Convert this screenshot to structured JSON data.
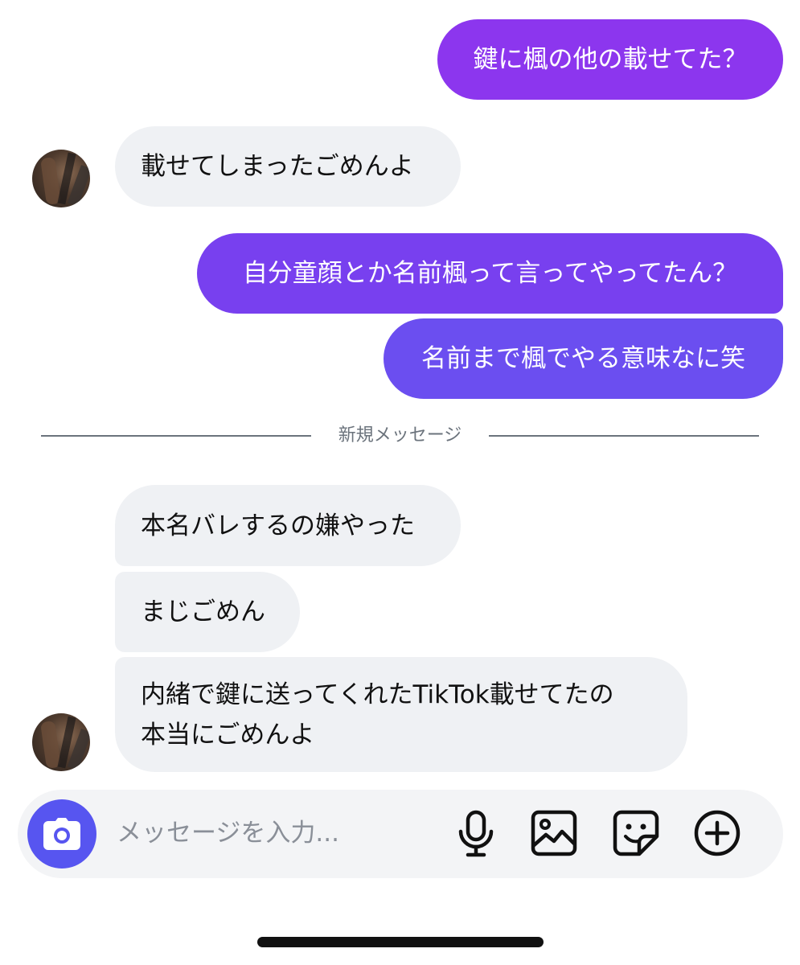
{
  "conversation": {
    "messages": [
      {
        "from": "me",
        "text": "鍵に楓の他の載せてた？"
      },
      {
        "from": "them",
        "text": "載せてしまったごめんよ"
      },
      {
        "from": "me",
        "text": "自分童顔とか名前楓って言ってやってたん？"
      },
      {
        "from": "me",
        "text": "名前まで楓でやる意味なに笑"
      },
      {
        "from": "them",
        "text": "本名バレするの嫌やった"
      },
      {
        "from": "them",
        "text": "まじごめん"
      },
      {
        "from": "them",
        "text": "内緒で鍵に送ってくれたTikTok載せてたの 本当にごめんよ",
        "lines": [
          "内緒で鍵に送ってくれたTikTok載せてたの",
          "本当にごめんよ"
        ]
      }
    ],
    "divider_label": "新規メッセージ"
  },
  "composer": {
    "placeholder": "メッセージを入力...",
    "buttons": [
      "camera-icon",
      "microphone-icon",
      "image-icon",
      "sticker-icon",
      "plus-circle-icon"
    ]
  },
  "colors": {
    "sent_gradient_top": "#8c35ee",
    "sent_gradient_bottom": "#6b4ff0",
    "received_bubble": "#eff1f4",
    "camera_button": "#5755f0",
    "divider": "#6b737c"
  }
}
